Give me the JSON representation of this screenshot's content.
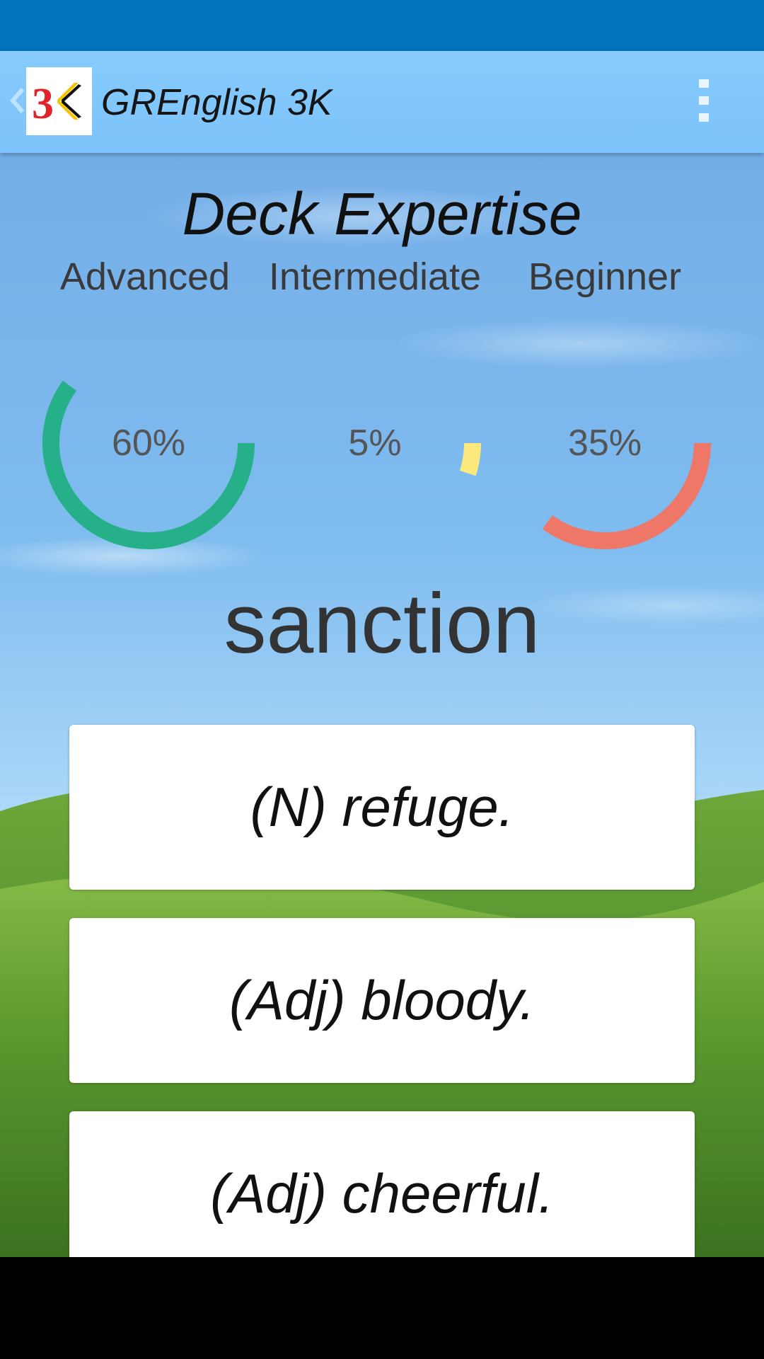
{
  "app": {
    "title": "GREnglish 3K",
    "logo_text": "3K"
  },
  "icons": {
    "back": "chevron-left-icon",
    "logo": "app-logo-icon",
    "menu": "overflow-menu-icon"
  },
  "header": {
    "title": "Deck Expertise"
  },
  "levels": [
    {
      "label": "Advanced",
      "value_text": "60%",
      "fraction": 0.6,
      "color": "#26b08a"
    },
    {
      "label": "Intermediate",
      "value_text": "5%",
      "fraction": 0.05,
      "color": "#fbe97e"
    },
    {
      "label": "Beginner",
      "value_text": "35%",
      "fraction": 0.35,
      "color": "#ee7768"
    }
  ],
  "quiz": {
    "word": "sanction",
    "answers": [
      "(N) refuge.",
      "(Adj) bloody.",
      "(Adj) cheerful."
    ]
  },
  "colors": {
    "status_bar": "#0273bd",
    "app_bar": "#87cbfd",
    "advanced": "#26b08a",
    "intermediate": "#fbe97e",
    "beginner": "#ee7768"
  }
}
